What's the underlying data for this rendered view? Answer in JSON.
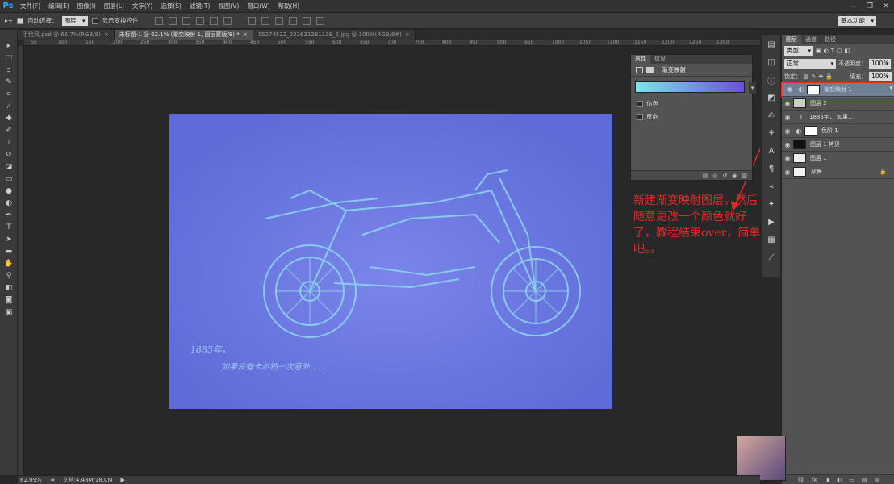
{
  "app": {
    "logo": "Ps"
  },
  "menu": [
    "文件(F)",
    "编辑(E)",
    "图像(I)",
    "图层(L)",
    "文字(Y)",
    "选择(S)",
    "滤镜(T)",
    "视图(V)",
    "窗口(W)",
    "帮助(H)"
  ],
  "window_controls": [
    "—",
    "❐",
    "✕"
  ],
  "options": {
    "auto_select_label": "自动选择：",
    "auto_select_value": "图层",
    "show_transform_label": "显示变换控件",
    "workspace": "基本功能"
  },
  "tabs": [
    "手绘风.psd @ 66.7%(RGB/8)",
    "未标题-1 @ 62.1% (渐变映射 1, 图层蒙版/8) *",
    "15274522_232631281139_2.jpg @ 100%(RGB/8#)"
  ],
  "tab_close": "×",
  "ruler_ticks": [
    "50",
    "100",
    "150",
    "200",
    "250",
    "300",
    "350",
    "400",
    "450",
    "500",
    "550",
    "600",
    "650",
    "700",
    "750",
    "800",
    "850",
    "900",
    "950",
    "1000",
    "1050",
    "1100",
    "1150",
    "1200",
    "1250",
    "1300"
  ],
  "canvas": {
    "caption1": "1885年，",
    "caption2": "如果没有卡尔铂一次意外……",
    "annotation": "新建渐变映射图层，然后随意更改一个颜色就好了，教程结束over，简单吧。。"
  },
  "properties": {
    "tabs": [
      "属性",
      "信息"
    ],
    "title": "渐变映射",
    "dither": "仿色",
    "reverse": "反向"
  },
  "layers": {
    "tabs": [
      "图层",
      "通道",
      "路径"
    ],
    "filter": "类型",
    "blend_mode": "正常",
    "opacity_label": "不透明度：",
    "opacity": "100%",
    "lock_label": "锁定：",
    "fill_label": "填充：",
    "fill": "100%",
    "items": [
      {
        "name": "渐变映射 1"
      },
      {
        "name": "图层 2"
      },
      {
        "name": "1885年，          如果..."
      },
      {
        "name": "色阶 1"
      },
      {
        "name": "图层 1 拷贝"
      },
      {
        "name": "图层 1"
      },
      {
        "name": "背景"
      }
    ]
  },
  "status": {
    "zoom": "62.09%",
    "doc": "文档:4.48M/18.0M"
  },
  "colors": {
    "accent": "#31a8ff",
    "canvas": "#6a77e0",
    "annotation": "#e02a2a",
    "selected_layer": "#6e7f96"
  }
}
